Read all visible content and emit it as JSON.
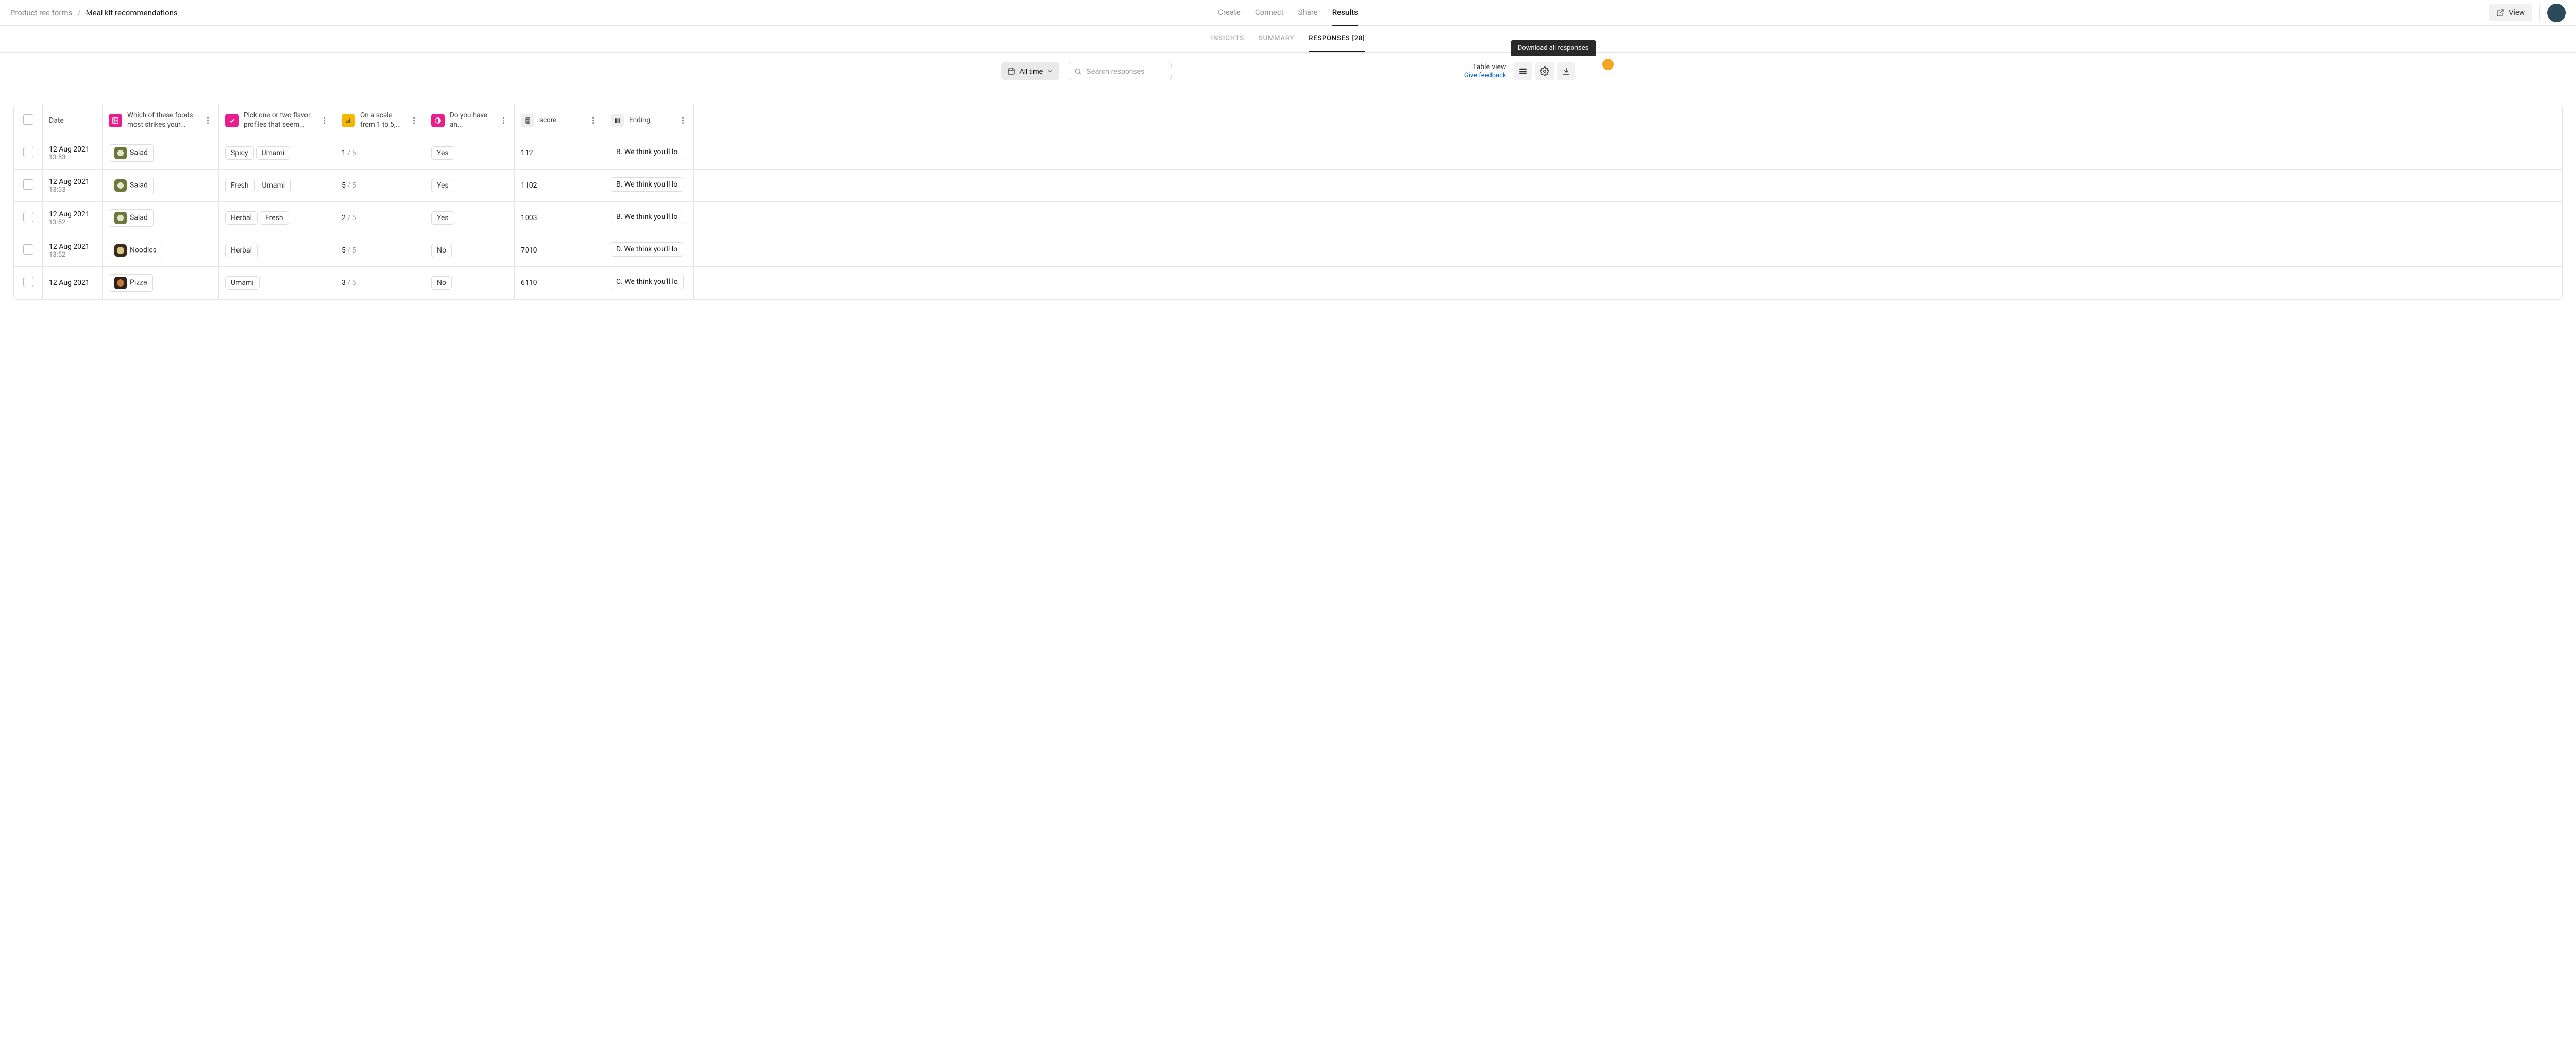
{
  "breadcrumb": {
    "parent": "Product rec forms",
    "sep": "/",
    "current": "Meal kit recommendations"
  },
  "topnav": {
    "items": [
      "Create",
      "Connect",
      "Share",
      "Results"
    ],
    "active": "Results",
    "view_label": "View"
  },
  "subnav": {
    "insights": "INSIGHTS",
    "summary": "SUMMARY",
    "responses": "RESPONSES [28]"
  },
  "toolbar": {
    "time_filter": "All time",
    "search_placeholder": "Search responses",
    "table_view": "Table view",
    "give_feedback": "Give feedback",
    "tooltip": "Download all responses"
  },
  "columns": {
    "date": "Date",
    "q1": "Which of these foods most strikes your...",
    "q2": "Pick one or two flavor profiles that seem...",
    "q3": "On a scale from 1 to 5,...",
    "q4": "Do you have an...",
    "score": "score",
    "ending": "Ending"
  },
  "rows": [
    {
      "date": "12 Aug 2021",
      "time": "13:53",
      "food": "Salad",
      "food_kind": "salad",
      "flavors": [
        "Spicy",
        "Umami"
      ],
      "scale_val": "1",
      "scale_max": "/ 5",
      "yn": "Yes",
      "score": "112",
      "ending": "B. We think you'll lo"
    },
    {
      "date": "12 Aug 2021",
      "time": "13:53",
      "food": "Salad",
      "food_kind": "salad",
      "flavors": [
        "Fresh",
        "Umami"
      ],
      "scale_val": "5",
      "scale_max": "/ 5",
      "yn": "Yes",
      "score": "1102",
      "ending": "B. We think you'll lo"
    },
    {
      "date": "12 Aug 2021",
      "time": "13:52",
      "food": "Salad",
      "food_kind": "salad",
      "flavors": [
        "Herbal",
        "Fresh"
      ],
      "scale_val": "2",
      "scale_max": "/ 5",
      "yn": "Yes",
      "score": "1003",
      "ending": "B. We think you'll lo"
    },
    {
      "date": "12 Aug 2021",
      "time": "13:52",
      "food": "Noodles",
      "food_kind": "noodles",
      "flavors": [
        "Herbal"
      ],
      "scale_val": "5",
      "scale_max": "/ 5",
      "yn": "No",
      "score": "7010",
      "ending": "D. We think you'll lo"
    },
    {
      "date": "12 Aug 2021",
      "time": "",
      "food": "Pizza",
      "food_kind": "pizza",
      "flavors": [
        "Umami"
      ],
      "scale_val": "3",
      "scale_max": "/ 5",
      "yn": "No",
      "score": "6110",
      "ending": "C. We think you'll lo"
    }
  ]
}
